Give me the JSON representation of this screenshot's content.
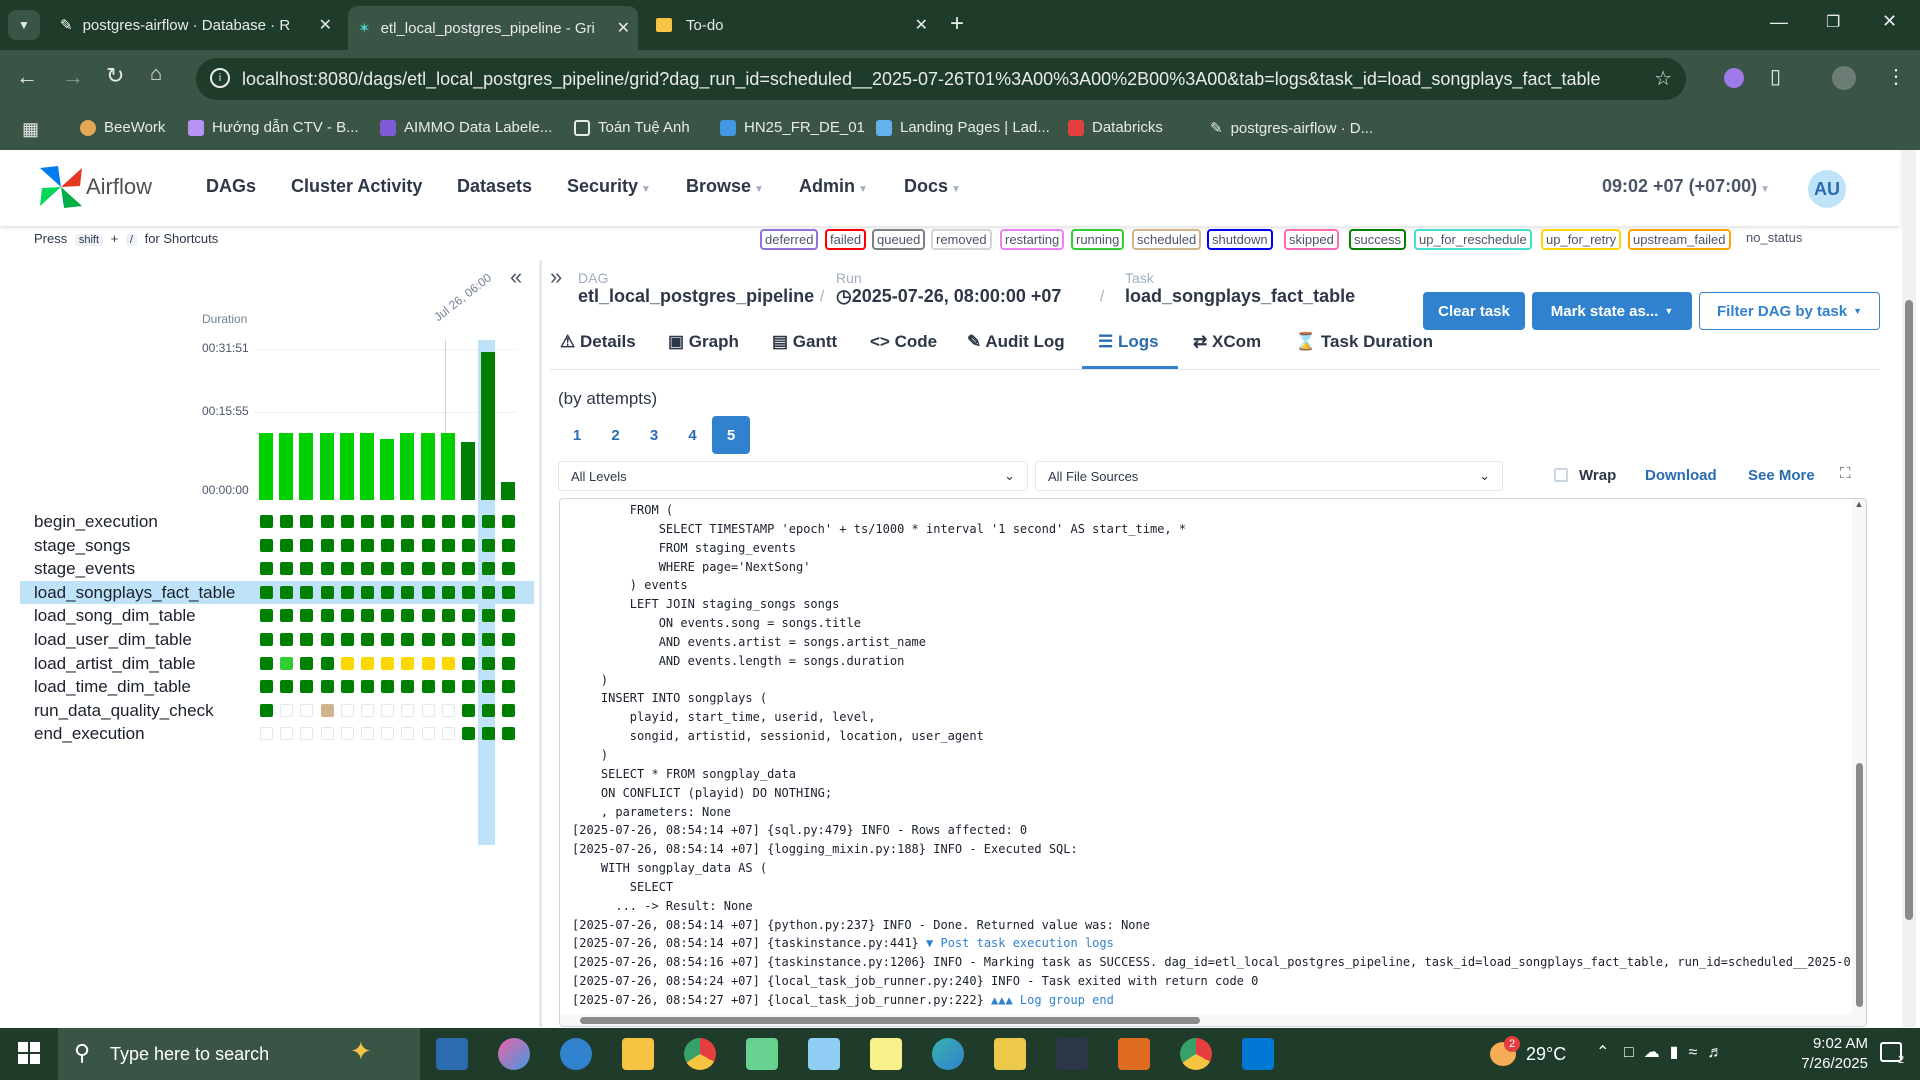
{
  "browser": {
    "tabs": [
      {
        "title": "postgres-airflow · Database · R"
      },
      {
        "title": "etl_local_postgres_pipeline - Gri"
      },
      {
        "title": "To-do"
      }
    ],
    "url": "localhost:8080/dags/etl_local_postgres_pipeline/grid?dag_run_id=scheduled__2025-07-26T01%3A00%3A00%2B00%3A00&tab=logs&task_id=load_songplays_fact_table",
    "bookmarks": [
      "BeeWork",
      "Hướng dẫn CTV - B...",
      "AIMMO Data Labele...",
      "Toán Tuệ Anh",
      "HN25_FR_DE_01",
      "Landing Pages | Lad...",
      "Databricks",
      "postgres-airflow · D..."
    ]
  },
  "navbar": {
    "brand": "Airflow",
    "items": [
      "DAGs",
      "Cluster Activity",
      "Datasets",
      "Security",
      "Browse",
      "Admin",
      "Docs"
    ],
    "time": "09:02 +07 (+07:00)",
    "user_initials": "AU"
  },
  "shortcuts": {
    "press": "Press",
    "key1": "shift",
    "plus": "+",
    "key2": "/",
    "suffix": "for Shortcuts"
  },
  "states": [
    {
      "label": "deferred",
      "color": "#9370db"
    },
    {
      "label": "failed",
      "color": "#ff0000"
    },
    {
      "label": "queued",
      "color": "#808080"
    },
    {
      "label": "removed",
      "color": "#d3d3d3"
    },
    {
      "label": "restarting",
      "color": "#ee82ee"
    },
    {
      "label": "running",
      "color": "#32cd32"
    },
    {
      "label": "scheduled",
      "color": "#d2b48c"
    },
    {
      "label": "shutdown",
      "color": "#0000ff"
    },
    {
      "label": "skipped",
      "color": "#ff69b4"
    },
    {
      "label": "success",
      "color": "#008000"
    },
    {
      "label": "up_for_reschedule",
      "color": "#40e0d0"
    },
    {
      "label": "up_for_retry",
      "color": "#ffd700"
    },
    {
      "label": "upstream_failed",
      "color": "#ffa500"
    },
    {
      "label": "no_status",
      "color": "#ffffff"
    }
  ],
  "grid": {
    "duration_label": "Duration",
    "y_ticks": [
      "00:31:51",
      "00:15:55",
      "00:00:00"
    ],
    "date_label": "Jul 26, 06:00",
    "durations_fraction": [
      0.45,
      0.45,
      0.45,
      0.45,
      0.45,
      0.45,
      0.41,
      0.45,
      0.45,
      0.45,
      0.39,
      1.0,
      0.12
    ],
    "tasks": [
      {
        "name": "begin_execution",
        "states": [
          "s",
          "s",
          "s",
          "s",
          "s",
          "s",
          "s",
          "s",
          "s",
          "s",
          "s",
          "s",
          "s"
        ]
      },
      {
        "name": "stage_songs",
        "states": [
          "s",
          "s",
          "s",
          "s",
          "s",
          "s",
          "s",
          "s",
          "s",
          "s",
          "s",
          "s",
          "s"
        ]
      },
      {
        "name": "stage_events",
        "states": [
          "s",
          "s",
          "s",
          "s",
          "s",
          "s",
          "s",
          "s",
          "s",
          "s",
          "s",
          "s",
          "s"
        ]
      },
      {
        "name": "load_songplays_fact_table",
        "states": [
          "s",
          "s",
          "s",
          "s",
          "s",
          "s",
          "s",
          "s",
          "s",
          "s",
          "s",
          "s",
          "s"
        ]
      },
      {
        "name": "load_song_dim_table",
        "states": [
          "s",
          "s",
          "s",
          "s",
          "s",
          "s",
          "s",
          "s",
          "s",
          "s",
          "s",
          "s",
          "s"
        ]
      },
      {
        "name": "load_user_dim_table",
        "states": [
          "s",
          "s",
          "s",
          "s",
          "s",
          "s",
          "s",
          "s",
          "s",
          "s",
          "s",
          "s",
          "s"
        ]
      },
      {
        "name": "load_artist_dim_table",
        "states": [
          "s",
          "r",
          "s",
          "s",
          "y",
          "y",
          "y",
          "y",
          "y",
          "y",
          "s",
          "s",
          "s"
        ]
      },
      {
        "name": "load_time_dim_table",
        "states": [
          "s",
          "s",
          "s",
          "s",
          "s",
          "s",
          "s",
          "s",
          "s",
          "s",
          "s",
          "s",
          "s"
        ]
      },
      {
        "name": "run_data_quality_check",
        "states": [
          "s",
          "n",
          "n",
          "t",
          "n",
          "n",
          "n",
          "n",
          "n",
          "n",
          "s",
          "s",
          "s"
        ]
      },
      {
        "name": "end_execution",
        "states": [
          "n",
          "n",
          "n",
          "n",
          "n",
          "n",
          "n",
          "n",
          "n",
          "n",
          "s",
          "s",
          "s"
        ]
      }
    ],
    "selected_task": "load_songplays_fact_table"
  },
  "details": {
    "crumb_dag_label": "DAG",
    "dag_id": "etl_local_postgres_pipeline",
    "crumb_run_label": "Run",
    "run": "2025-07-26, 08:00:00 +07",
    "crumb_task_label": "Task",
    "task_id": "load_songplays_fact_table",
    "clear_button": "Clear task",
    "mark_state_button": "Mark state as...",
    "filter_button": "Filter DAG by task",
    "tabs": [
      "Details",
      "Graph",
      "Gantt",
      "Code",
      "Audit Log",
      "Logs",
      "XCom",
      "Task Duration"
    ],
    "active_tab": "Logs"
  },
  "logs": {
    "by_attempts": "(by attempts)",
    "attempts": [
      "1",
      "2",
      "3",
      "4",
      "5"
    ],
    "selected_attempt": "5",
    "level_select": "All Levels",
    "source_select": "All File Sources",
    "wrap_label": "Wrap",
    "download_label": "Download",
    "see_more_label": "See More",
    "lines": [
      "        FROM (",
      "            SELECT TIMESTAMP 'epoch' + ts/1000 * interval '1 second' AS start_time, *",
      "            FROM staging_events",
      "            WHERE page='NextSong'",
      "        ) events",
      "        LEFT JOIN staging_songs songs",
      "            ON events.song = songs.title",
      "            AND events.artist = songs.artist_name",
      "            AND events.length = songs.duration",
      "    )",
      "    INSERT INTO songplays (",
      "        playid, start_time, userid, level,",
      "        songid, artistid, sessionid, location, user_agent",
      "    )",
      "    SELECT * FROM songplay_data",
      "    ON CONFLICT (playid) DO NOTHING;",
      "    , parameters: None",
      "[2025-07-26, 08:54:14 +07] {sql.py:479} INFO - Rows affected: 0",
      "[2025-07-26, 08:54:14 +07] {logging_mixin.py:188} INFO - Executed SQL:",
      "    WITH songplay_data AS (",
      "        SELECT",
      "      ... -> Result: None",
      "[2025-07-26, 08:54:14 +07] {python.py:237} INFO - Done. Returned value was: None",
      "[2025-07-26, 08:54:14 +07] {taskinstance.py:441} ",
      "[2025-07-26, 08:54:16 +07] {taskinstance.py:1206} INFO - Marking task as SUCCESS. dag_id=etl_local_postgres_pipeline, task_id=load_songplays_fact_table, run_id=scheduled__2025-0",
      "[2025-07-26, 08:54:24 +07] {local_task_job_runner.py:240} INFO - Task exited with return code 0",
      "[2025-07-26, 08:54:27 +07] {local_task_job_runner.py:222} "
    ],
    "post_task_link": "▼ Post task execution logs",
    "group_end_link": "▲▲▲ Log group end"
  },
  "taskbar": {
    "search_placeholder": "Type here to search",
    "weather": "29°C",
    "weather_badge": "2",
    "time": "9:02 AM",
    "date": "7/26/2025",
    "notif": "2"
  },
  "colors": {
    "success": "#008000",
    "running": "#32cd32",
    "up_for_retry": "#ffd700",
    "scheduled": "#d2b48c",
    "bar": "#00d000",
    "primary": "#3182ce"
  }
}
